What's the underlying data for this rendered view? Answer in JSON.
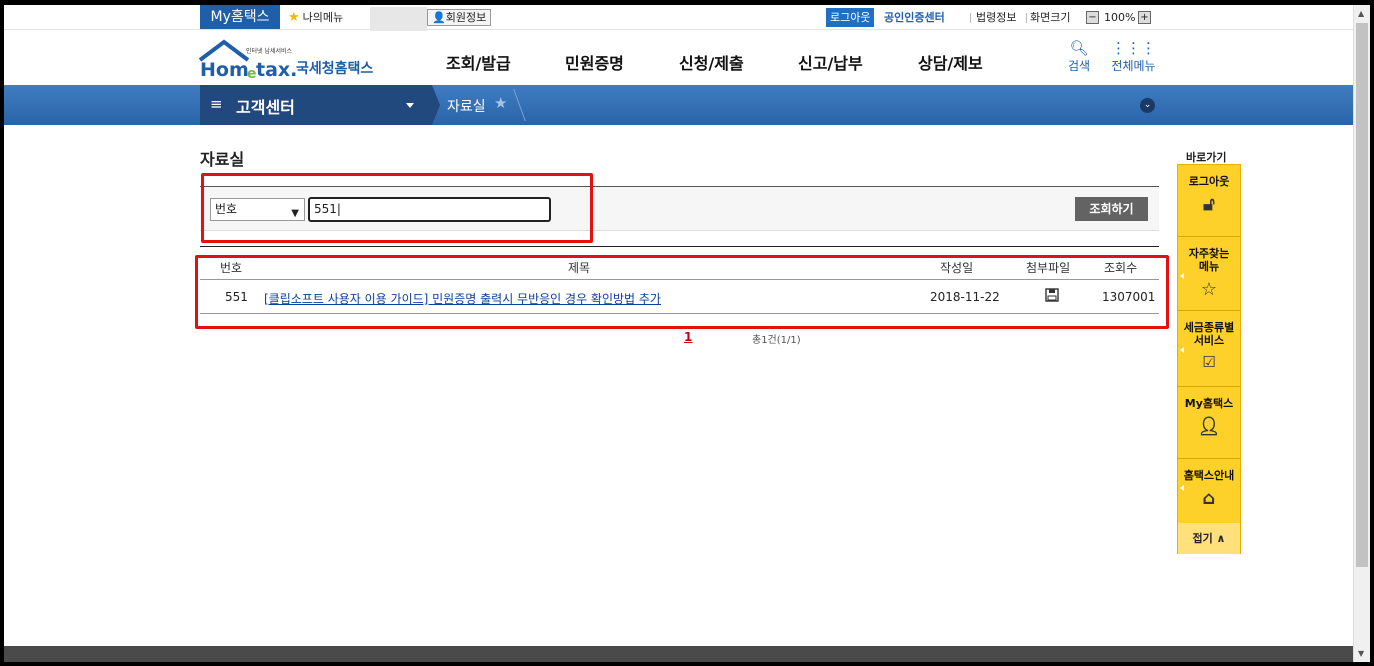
{
  "topbar": {
    "my_hometax": "My홈택스",
    "my_menu": "나의메뉴",
    "member_info": "회원정보",
    "logout": "로그아웃",
    "cert_center": "공인인증센터",
    "law_info": "법령정보",
    "screen_size": "화면크기",
    "zoom_minus": "−",
    "zoom_level": "100%",
    "zoom_plus": "+"
  },
  "header": {
    "logo_small": "인터넷 납세서비스",
    "logo_brand": "Hometax.",
    "logo_name": "국세청홈택스",
    "menu": [
      "조회/발급",
      "민원증명",
      "신청/제출",
      "신고/납부",
      "상담/제보"
    ],
    "search_label": "검색",
    "all_menu_label": "전체메뉴"
  },
  "navbar": {
    "section": "고객센터",
    "breadcrumb": "자료실"
  },
  "main": {
    "page_title": "자료실",
    "search": {
      "select_value": "번호",
      "input_value": "551",
      "button": "조회하기"
    },
    "table": {
      "headers": [
        "번호",
        "제목",
        "작성일",
        "첨부파일",
        "조회수"
      ],
      "rows": [
        {
          "no": "551",
          "title": "[클립소프트 사용자 이용 가이드] 민원증명 출력시 무반응인 경우 확인방법 추가",
          "date": "2018-11-22",
          "attachment_icon": "floppy-disk-icon",
          "views": "1307001"
        }
      ]
    },
    "paging": {
      "current_page": "1",
      "total": "총1건(1/1)"
    }
  },
  "quick_menu": {
    "title": "바로가기",
    "items": [
      {
        "label": "로그아웃",
        "icon": "unlock-icon"
      },
      {
        "label": "자주찾는\n메뉴",
        "icon": "star-icon"
      },
      {
        "label": "세금종류별\n서비스",
        "icon": "checkbox-icon"
      },
      {
        "label": "My홈택스",
        "icon": "user-icon"
      },
      {
        "label": "홈택스안내",
        "icon": "house-icon"
      }
    ],
    "close": "접기 ∧"
  },
  "colors": {
    "brand_blue": "#1f5ea8",
    "nav_dark": "#21497e",
    "quick_yellow": "#fdd12a",
    "annotation_red": "#e31212"
  }
}
